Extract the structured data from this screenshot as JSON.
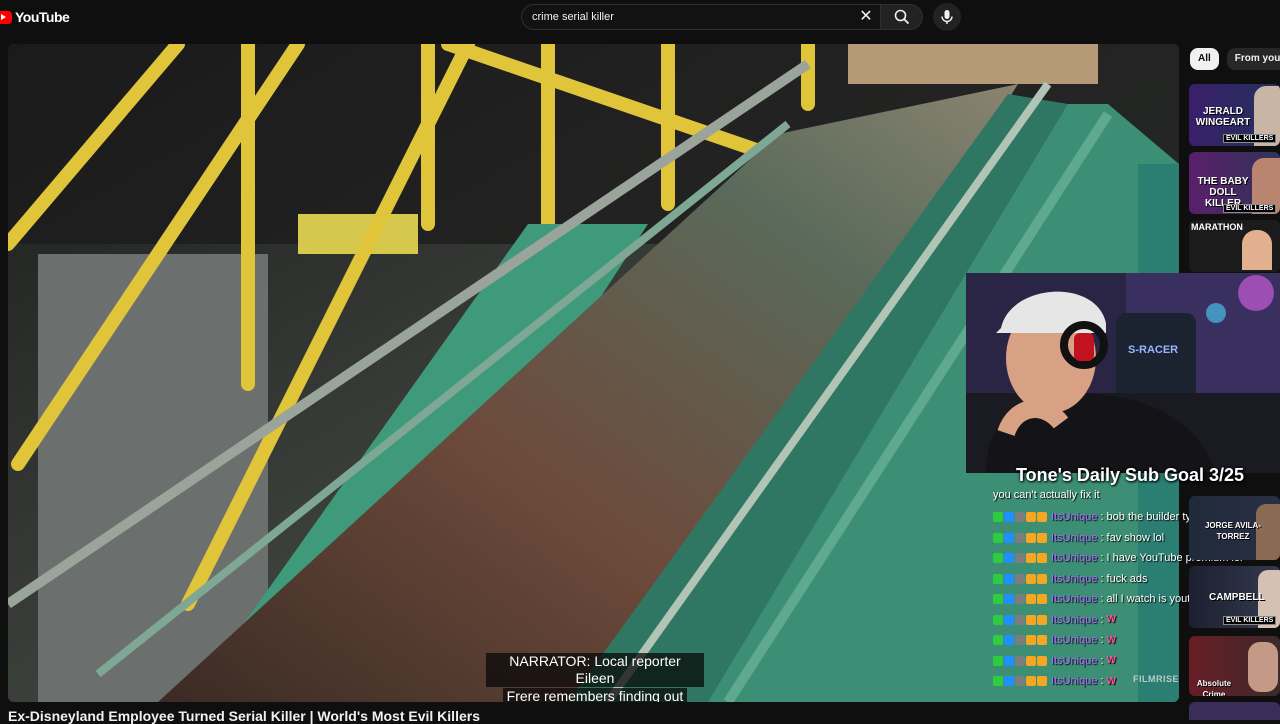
{
  "app": {
    "logo_text": "YouTube"
  },
  "search": {
    "value": "crime serial killer"
  },
  "player": {
    "captions": [
      "NARRATOR: Local reporter Eileen",
      "Frere remembers finding out"
    ]
  },
  "stream_overlay": {
    "goal_text": "Tone's Daily Sub Goal 3/25",
    "chat_first_line": "you can't actually fix it",
    "messages": [
      {
        "user": "ItsUnique",
        "text": "bob the builder type shit"
      },
      {
        "user": "ItsUnique",
        "text": "fav show lol"
      },
      {
        "user": "ItsUnique",
        "text": "I have YouTube premium lol"
      },
      {
        "user": "ItsUnique",
        "text": "fuck ads"
      },
      {
        "user": "ItsUnique",
        "text": "all I watch is youtube"
      },
      {
        "user": "ItsUnique",
        "text": "W"
      },
      {
        "user": "ItsUnique",
        "text": "W"
      },
      {
        "user": "ItsUnique",
        "text": "W"
      },
      {
        "user": "ItsUnique",
        "text": "W"
      }
    ],
    "watermark": "FILMRISE",
    "colors": {
      "username": "#a970ff",
      "emote": "#ff4fa3"
    }
  },
  "video": {
    "title": "Ex-Disneyland Employee Turned Serial Killer | World's Most Evil Killers"
  },
  "sidebar": {
    "chips": [
      "All",
      "From your s"
    ],
    "thumbs": [
      {
        "title": "JERALD WINGEART",
        "badge": "EVIL KILLERS"
      },
      {
        "title": "THE BABY DOLL KILLER",
        "badge": "EVIL KILLERS"
      },
      {
        "title": "MARATHON",
        "badge": ""
      },
      {
        "title": "JORGE AVILA-TORREZ",
        "badge": ""
      },
      {
        "title": "CAMPBELL",
        "badge": "EVIL KILLERS"
      },
      {
        "title": "Absolute Crime",
        "badge": ""
      }
    ]
  }
}
